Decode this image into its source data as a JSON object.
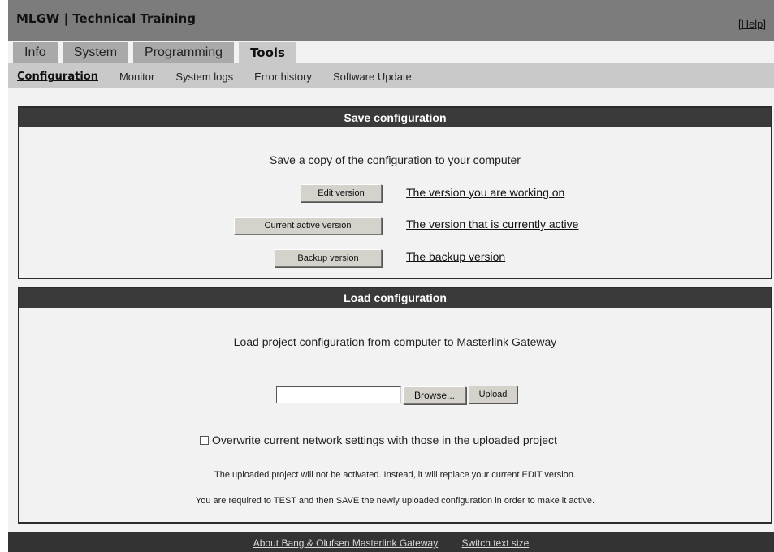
{
  "header": {
    "title": "MLGW | Technical Training",
    "help_link": "[Help]"
  },
  "main_tabs": [
    {
      "label": "Info",
      "active": false
    },
    {
      "label": "System",
      "active": false
    },
    {
      "label": "Programming",
      "active": false
    },
    {
      "label": "Tools",
      "active": true
    }
  ],
  "sub_tabs": [
    {
      "label": "Configuration",
      "active": true
    },
    {
      "label": "Monitor",
      "active": false
    },
    {
      "label": "System logs",
      "active": false
    },
    {
      "label": "Error history",
      "active": false
    },
    {
      "label": "Software Update",
      "active": false
    }
  ],
  "save_panel": {
    "heading": "Save configuration",
    "intro": "Save a copy of the configuration to your computer",
    "edit_button": "Edit version",
    "edit_link": "The version you are working on",
    "current_button": "Current active version",
    "current_link": "The version that is currently active",
    "backup_button": "Backup version",
    "backup_link": "The backup version"
  },
  "load_panel": {
    "heading": "Load configuration",
    "intro": "Load project configuration from computer to Masterlink Gateway",
    "file_value": "",
    "browse_button": "Browse...",
    "upload_button": "Upload",
    "overwrite_label": "Overwrite current network settings with those in the uploaded project",
    "overwrite_checked": false,
    "note_1": "The uploaded project will not be activated. Instead, it will replace your current EDIT version.",
    "note_2": "You are required to TEST and then SAVE the newly uploaded configuration in order to make it active."
  },
  "footer": {
    "about_link": "About Bang & Olufsen Masterlink Gateway",
    "textsize_link": "Switch text size"
  },
  "colors": {
    "title_bar": "#7c7c7c",
    "inactive_tab": "#a9a9a9",
    "active_tab": "#c9c9c9",
    "panel_header": "#3a3a3a",
    "footer": "#333333",
    "background": "#f2f2f2"
  }
}
